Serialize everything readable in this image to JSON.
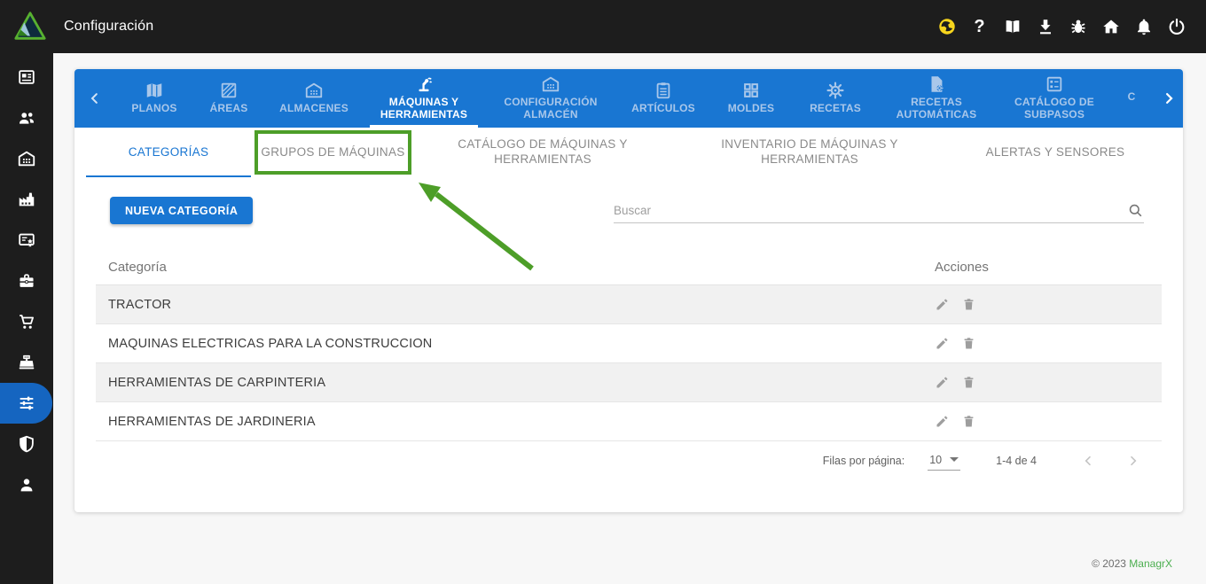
{
  "topbar": {
    "title": "Configuración",
    "icon_names": [
      "language-icon",
      "help-icon",
      "manual-icon",
      "download-icon",
      "bug-report-icon",
      "home-icon",
      "notifications-icon",
      "power-icon"
    ]
  },
  "sidebar": {
    "icon_names": [
      "news-icon",
      "users-icon",
      "warehouse-icon",
      "factory-icon",
      "certificate-icon",
      "briefcase-icon",
      "cart-icon",
      "register-icon",
      "settings-icon",
      "security-icon",
      "profile-icon"
    ],
    "active_icon": "settings-icon"
  },
  "main_tabs": {
    "items": [
      {
        "label": "PLANOS",
        "icon": "map-icon"
      },
      {
        "label": "ÁREAS",
        "icon": "area-icon"
      },
      {
        "label": "ALMACENES",
        "icon": "warehouse-icon"
      },
      {
        "label": "MÁQUINAS Y HERRAMIENTAS",
        "icon": "robot-arm-icon"
      },
      {
        "label": "CONFIGURACIÓN ALMACÉN",
        "icon": "warehouse-icon"
      },
      {
        "label": "ARTÍCULOS",
        "icon": "clipboard-icon"
      },
      {
        "label": "MOLDES",
        "icon": "grid-icon"
      },
      {
        "label": "RECETAS",
        "icon": "gear-icon"
      },
      {
        "label": "RECETAS AUTOMÁTICAS",
        "icon": "file-gear-icon"
      },
      {
        "label": "CATÁLOGO DE SUBPASOS",
        "icon": "list-card-icon"
      },
      {
        "label": "C",
        "icon": ""
      }
    ],
    "active": "MÁQUINAS Y HERRAMIENTAS"
  },
  "sub_tabs": {
    "items": [
      "CATEGORÍAS",
      "GRUPOS DE MÁQUINAS",
      "CATÁLOGO DE MÁQUINAS Y HERRAMIENTAS",
      "INVENTARIO DE MÁQUINAS Y HERRAMIENTAS",
      "ALERTAS Y SENSORES"
    ],
    "active": "CATEGORÍAS",
    "annotated": "GRUPOS DE MÁQUINAS"
  },
  "toolbar": {
    "new_button": "NUEVA CATEGORÍA",
    "search_placeholder": "Buscar"
  },
  "table": {
    "columns": [
      "Categoría",
      "Acciones"
    ],
    "rows": [
      "TRACTOR",
      "MAQUINAS ELECTRICAS PARA LA CONSTRUCCION",
      "HERRAMIENTAS DE CARPINTERIA",
      "HERRAMIENTAS DE JARDINERIA"
    ],
    "row_action_icons": [
      "edit-icon",
      "delete-icon"
    ]
  },
  "pagination": {
    "label": "Filas por página:",
    "per_page": "10",
    "range": "1-4 de 4"
  },
  "footer": {
    "copyright": "© 2023",
    "brand": "ManagrX"
  },
  "colors": {
    "primary_blue": "#1976d2",
    "sidebar_active_blue": "#1565c0",
    "topbar_dark": "#1d1d1d",
    "annotation_green": "#4d9e28",
    "brand_green": "#4caf50",
    "language_icon_yellow": "#f7d51d"
  }
}
